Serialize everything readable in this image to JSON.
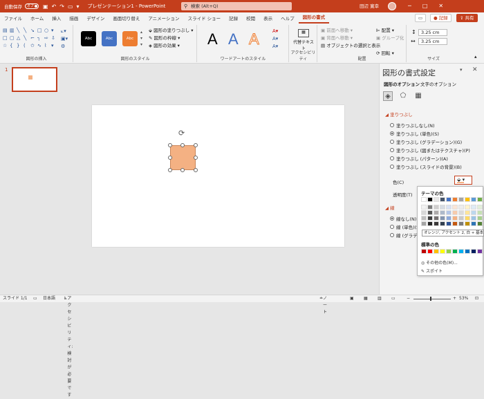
{
  "titlebar": {
    "autosave": "自動保存",
    "toggle": "オフ",
    "title": "プレゼンテーション1 - PowerPoint",
    "search": "検索 (Alt+Q)",
    "user": "田辺 寛幸",
    "minimize": "─",
    "maximize": "□",
    "close": "✕"
  },
  "menu": {
    "tabs": [
      "ファイル",
      "ホーム",
      "挿入",
      "描画",
      "デザイン",
      "画面切り替え",
      "アニメーション",
      "スライド ショー",
      "記録",
      "校閲",
      "表示",
      "ヘルプ",
      "図形の書式"
    ],
    "active": "図形の書式",
    "record": "記録",
    "share": "共有"
  },
  "ribbon": {
    "insert_shapes": "図形の挿入",
    "shape_styles": "図形のスタイル",
    "style_label": "Abc",
    "style_colors": [
      "#000000",
      "#4472c4",
      "#ed7d31"
    ],
    "fill": "図形の塗りつぶし",
    "outline": "図形の枠線",
    "effects": "図形の効果",
    "wordart_styles": "ワードアートのスタイル",
    "wordart_letter": "A",
    "accessibility": "アクセシビリティ",
    "alt_text": "代替テキスト",
    "arrange": "配置",
    "bring_forward": "前面へ移動",
    "send_backward": "背面へ移動",
    "selection_pane": "オブジェクトの選択と表示",
    "align": "配置",
    "group": "グループ化",
    "rotate": "回転",
    "size": "サイズ",
    "height": "3.25 cm",
    "width": "3.25 cm"
  },
  "slide_panel": {
    "number": "1"
  },
  "pane": {
    "title": "図形の書式設定",
    "tab_shape": "図形のオプション",
    "tab_text": "文字のオプション",
    "fill_section": "塗りつぶし",
    "fill_options": [
      "塗りつぶしなし(N)",
      "塗りつぶし (単色)(S)",
      "塗りつぶし (グラデーション)(G)",
      "塗りつぶし (図またはテクスチャ)(P)",
      "塗りつぶし (パターン)(A)",
      "塗りつぶし (スライドの背景)(B)"
    ],
    "color_label": "色(C)",
    "transparency_label": "透明度(T)",
    "line_section": "線",
    "line_options": [
      "線なし(N)",
      "線 (単色)(S)",
      "線 (グラデーション)(G)"
    ]
  },
  "palette": {
    "theme_header": "テーマの色",
    "standard_header": "標準の色",
    "tooltip": "オレンジ, アクセント 2, 白 + 基本色 40%",
    "more_colors": "その他の色(M)...",
    "eyedropper": "スポイト",
    "theme_colors": [
      "#ffffff",
      "#000000",
      "#e7e6e6",
      "#44546a",
      "#4472c4",
      "#ed7d31",
      "#a5a5a5",
      "#ffc000",
      "#5b9bd5",
      "#70ad47"
    ],
    "shade_rows": [
      [
        "#f2f2f2",
        "#7f7f7f",
        "#d0cece",
        "#d6dce4",
        "#d9e2f3",
        "#fbe5d5",
        "#ededed",
        "#fff2cc",
        "#deebf6",
        "#e2efd9"
      ],
      [
        "#d8d8d8",
        "#595959",
        "#aeabab",
        "#adb9ca",
        "#b4c6e7",
        "#f7cbac",
        "#dbdbdb",
        "#fee599",
        "#bdd7ee",
        "#c5e0b3"
      ],
      [
        "#bfbfbf",
        "#3f3f3f",
        "#757070",
        "#8496b0",
        "#8eaadb",
        "#f4b183",
        "#c9c9c9",
        "#ffd965",
        "#9cc3e5",
        "#a8d08d"
      ],
      [
        "#a5a5a5",
        "#262626",
        "#3a3838",
        "#323f4f",
        "#2f5496",
        "#c55a11",
        "#7b7b7b",
        "#bf8f00",
        "#2e75b5",
        "#538135"
      ]
    ],
    "standard_colors": [
      "#c00000",
      "#ff0000",
      "#ffc000",
      "#ffff00",
      "#92d050",
      "#00b050",
      "#00b0f0",
      "#0070c0",
      "#002060",
      "#7030a0"
    ]
  },
  "status": {
    "slide": "スライド 1/1",
    "lang": "日本語",
    "accessibility": "アクセシビリティ: 検討が必要です",
    "notes": "ノート",
    "zoom": "53%"
  }
}
